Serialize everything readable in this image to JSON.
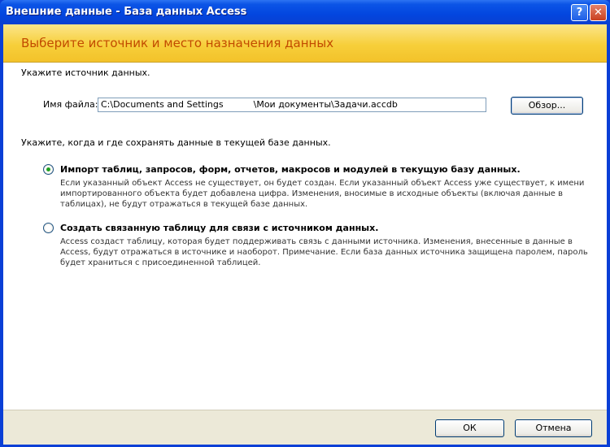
{
  "window": {
    "title": "Внешние данные - База данных Access",
    "help_glyph": "?",
    "close_glyph": "✕"
  },
  "banner": {
    "title": "Выберите источник и место назначения данных"
  },
  "source": {
    "heading": "Укажите источник данных.",
    "file_label": "Имя файла:",
    "file_path_start": "C:\\Documents and Settings",
    "file_path_end": "\\Мои документы\\Задачи.accdb",
    "browse_label": "Обзор..."
  },
  "destination": {
    "heading": "Укажите, когда и где сохранять данные в текущей базе данных.",
    "options": [
      {
        "label": "Импорт таблиц, запросов, форм, отчетов, макросов и модулей в текущую базу данных.",
        "selected": true,
        "description": [
          "Если указанный объект Access не существует, он будет создан. Если указанный объект Access уже существует, к имени",
          "импортированного объекта будет добавлена цифра. Изменения, вносимые в исходные объекты (включая данные в",
          "таблицах), не будут отражаться в текущей базе данных."
        ]
      },
      {
        "label": "Создать связанную таблицу для связи с источником данных.",
        "selected": false,
        "description": [
          "Access создаст таблицу, которая будет поддерживать связь с данными источника. Изменения, внесенные в данные в",
          "Access, будут отражаться в источнике и наоборот. Примечание. Если база данных источника защищена паролем, пароль",
          "будет храниться с присоединенной таблицей."
        ]
      }
    ]
  },
  "footer": {
    "ok_label": "ОК",
    "cancel_label": "Отмена"
  },
  "colors": {
    "titlebar": "#0b54e6",
    "banner": "#f7cf3a",
    "banner_text": "#c24b00",
    "dialog_face": "#ece9d8",
    "radio_dot": "#21a121"
  }
}
